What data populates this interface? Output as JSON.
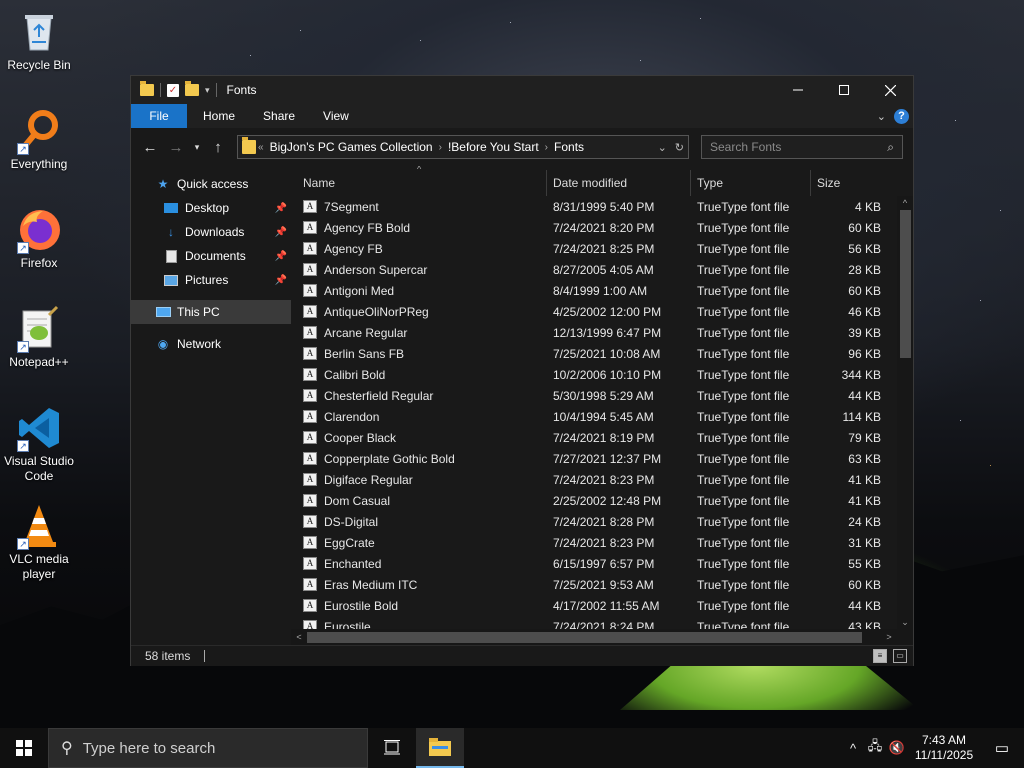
{
  "desktop": {
    "icons": [
      {
        "label": "Recycle Bin"
      },
      {
        "label": "Everything"
      },
      {
        "label": "Firefox"
      },
      {
        "label": "Notepad++"
      },
      {
        "label": "Visual Studio Code"
      },
      {
        "label": "VLC media player"
      }
    ]
  },
  "window": {
    "title": "Fonts",
    "ribbon_tabs": [
      "File",
      "Home",
      "Share",
      "View"
    ],
    "address": {
      "overflow": "«",
      "crumbs": [
        "BigJon's PC Games Collection",
        "!Before You Start",
        "Fonts"
      ]
    },
    "search": {
      "placeholder": "Search Fonts"
    },
    "nav_pane": {
      "quick_access": "Quick access",
      "desktop": "Desktop",
      "downloads": "Downloads",
      "documents": "Documents",
      "pictures": "Pictures",
      "this_pc": "This PC",
      "network": "Network"
    },
    "columns": {
      "name": "Name",
      "date": "Date modified",
      "type": "Type",
      "size": "Size"
    },
    "files": [
      {
        "name": "7Segment",
        "date": "8/31/1999 5:40 PM",
        "type": "TrueType font file",
        "size": "4 KB"
      },
      {
        "name": "Agency FB Bold",
        "date": "7/24/2021 8:20 PM",
        "type": "TrueType font file",
        "size": "60 KB"
      },
      {
        "name": "Agency FB",
        "date": "7/24/2021 8:25 PM",
        "type": "TrueType font file",
        "size": "56 KB"
      },
      {
        "name": "Anderson Supercar",
        "date": "8/27/2005 4:05 AM",
        "type": "TrueType font file",
        "size": "28 KB"
      },
      {
        "name": "Antigoni Med",
        "date": "8/4/1999 1:00 AM",
        "type": "TrueType font file",
        "size": "60 KB"
      },
      {
        "name": "AntiqueOliNorPReg",
        "date": "4/25/2002 12:00 PM",
        "type": "TrueType font file",
        "size": "46 KB"
      },
      {
        "name": "Arcane Regular",
        "date": "12/13/1999 6:47 PM",
        "type": "TrueType font file",
        "size": "39 KB"
      },
      {
        "name": "Berlin Sans FB",
        "date": "7/25/2021 10:08 AM",
        "type": "TrueType font file",
        "size": "96 KB"
      },
      {
        "name": "Calibri Bold",
        "date": "10/2/2006 10:10 PM",
        "type": "TrueType font file",
        "size": "344 KB"
      },
      {
        "name": "Chesterfield Regular",
        "date": "5/30/1998 5:29 AM",
        "type": "TrueType font file",
        "size": "44 KB"
      },
      {
        "name": "Clarendon",
        "date": "10/4/1994 5:45 AM",
        "type": "TrueType font file",
        "size": "114 KB"
      },
      {
        "name": "Cooper Black",
        "date": "7/24/2021 8:19 PM",
        "type": "TrueType font file",
        "size": "79 KB"
      },
      {
        "name": "Copperplate Gothic Bold",
        "date": "7/27/2021 12:37 PM",
        "type": "TrueType font file",
        "size": "63 KB"
      },
      {
        "name": "Digiface Regular",
        "date": "7/24/2021 8:23 PM",
        "type": "TrueType font file",
        "size": "41 KB"
      },
      {
        "name": "Dom Casual",
        "date": "2/25/2002 12:48 PM",
        "type": "TrueType font file",
        "size": "41 KB"
      },
      {
        "name": "DS-Digital",
        "date": "7/24/2021 8:28 PM",
        "type": "TrueType font file",
        "size": "24 KB"
      },
      {
        "name": "EggCrate",
        "date": "7/24/2021 8:23 PM",
        "type": "TrueType font file",
        "size": "31 KB"
      },
      {
        "name": "Enchanted",
        "date": "6/15/1997 6:57 PM",
        "type": "TrueType font file",
        "size": "55 KB"
      },
      {
        "name": "Eras Medium ITC",
        "date": "7/25/2021 9:53 AM",
        "type": "TrueType font file",
        "size": "60 KB"
      },
      {
        "name": "Eurostile Bold",
        "date": "4/17/2002 11:55 AM",
        "type": "TrueType font file",
        "size": "44 KB"
      },
      {
        "name": "Eurostile",
        "date": "7/24/2021 8:24 PM",
        "type": "TrueType font file",
        "size": "43 KB"
      }
    ],
    "status": {
      "items": "58 items"
    }
  },
  "taskbar": {
    "search_placeholder": "Type here to search",
    "time": "7:43 AM",
    "date": "11/11/2025"
  },
  "colors": {
    "accent": "#1a73c8",
    "window_bg": "#191919",
    "taskbar_bg": "#101010"
  }
}
